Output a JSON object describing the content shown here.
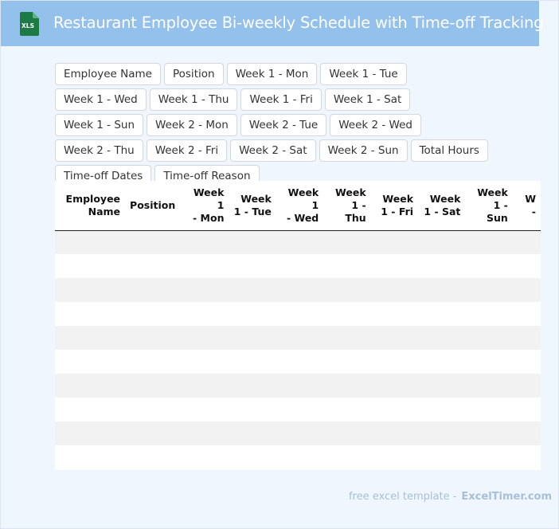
{
  "header": {
    "icon_label": "XLS",
    "title": "Restaurant Employee Bi-weekly Schedule with Time-off Tracking"
  },
  "columns": [
    "Employee Name",
    "Position",
    "Week 1 - Mon",
    "Week 1 - Tue",
    "Week 1 - Wed",
    "Week 1 - Thu",
    "Week 1 - Fri",
    "Week 1 - Sat",
    "Week 1 - Sun",
    "Week 2 - Mon",
    "Week 2 - Tue",
    "Week 2 - Wed",
    "Week 2 - Thu",
    "Week 2 - Fri",
    "Week 2 - Sat",
    "Week 2 - Sun",
    "Total Hours",
    "Time-off Dates",
    "Time-off Reason"
  ],
  "table": {
    "headers": [
      [
        "Employee",
        "Name"
      ],
      [
        "Position"
      ],
      [
        "Week 1",
        "- Mon"
      ],
      [
        "Week",
        "1 - Tue"
      ],
      [
        "Week 1",
        "- Wed"
      ],
      [
        "Week",
        "1 - Thu"
      ],
      [
        "Week",
        "1 - Fri"
      ],
      [
        "Week",
        "1 - Sat"
      ],
      [
        "Week",
        "1 - Sun"
      ],
      [
        "W",
        "-"
      ]
    ],
    "row_count": 10
  },
  "footer": {
    "text": "free excel template -",
    "brand": "ExcelTimer.com"
  },
  "colors": {
    "header_bg": "#94c1ec",
    "page_bg": "#f0f6fd",
    "icon_green": "#1e7a45",
    "stripe": "#f2f2f2",
    "footer_text": "#a7bfd8"
  }
}
